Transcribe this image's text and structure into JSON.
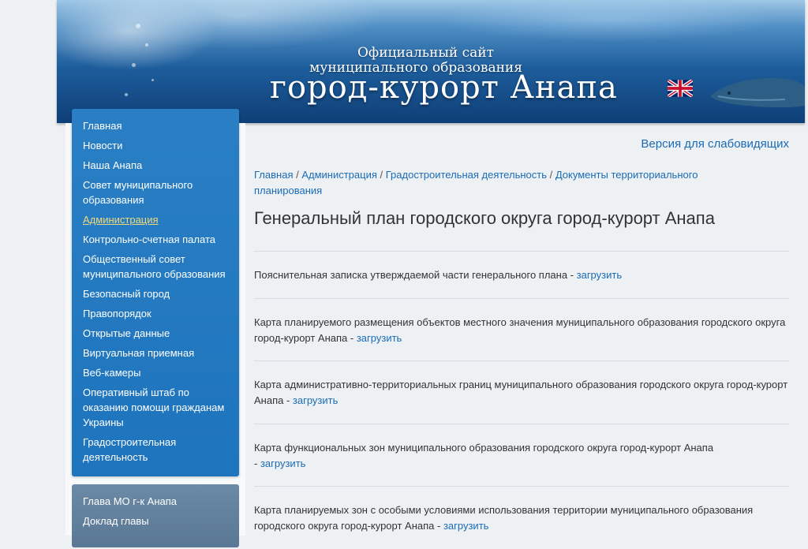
{
  "header": {
    "subtitle_line1": "Официальный сайт",
    "subtitle_line2": "муниципального образования",
    "site_name": "город-курорт Анапа"
  },
  "sidebar": {
    "items": [
      {
        "label": "Главная"
      },
      {
        "label": "Новости"
      },
      {
        "label": "Наша Анапа"
      },
      {
        "label": "Совет муниципального образования"
      },
      {
        "label": "Администрация",
        "active": true
      },
      {
        "label": "Контрольно-счетная палата"
      },
      {
        "label": "Общественный совет муниципального образования"
      },
      {
        "label": "Безопасный город"
      },
      {
        "label": "Правопорядок"
      },
      {
        "label": "Открытые данные"
      },
      {
        "label": "Виртуальная приемная"
      },
      {
        "label": "Веб-камеры"
      },
      {
        "label": "Оперативный штаб по оказанию помощи гражданам Украины"
      },
      {
        "label": "Градостроительная деятельность"
      }
    ],
    "secondary": [
      {
        "label": "Глава МО г-к Анапа"
      },
      {
        "label": "Доклад главы"
      }
    ]
  },
  "content": {
    "vision_link": "Версия для слабовидящих",
    "breadcrumbs": [
      "Главная",
      "Администрация",
      "Градостроительная деятельность",
      "Документы территориального планирования"
    ],
    "breadcrumb_sep": " / ",
    "title": "Генеральный план городского округа город-курорт Анапа",
    "documents": [
      {
        "text": "Пояснительная записка утверждаемой части генерального плана - ",
        "link": "загрузить"
      },
      {
        "text": "Карта планируемого размещения объектов местного значения муниципального образования городского округа город-курорт Анапа - ",
        "link": "загрузить"
      },
      {
        "text": "Карта административно-территориальных границ муниципального образования городского округа город-курорт Анапа - ",
        "link": "загрузить"
      },
      {
        "text": "Карта функциональных зон муниципального образования городского округа город-курорт Анапа",
        "text2": "- ",
        "link": "загрузить"
      },
      {
        "text": "Карта планируемых зон с особыми условиями использования территории муниципального образования городского округа город-курорт Анапа - ",
        "link": "загрузить"
      }
    ]
  }
}
